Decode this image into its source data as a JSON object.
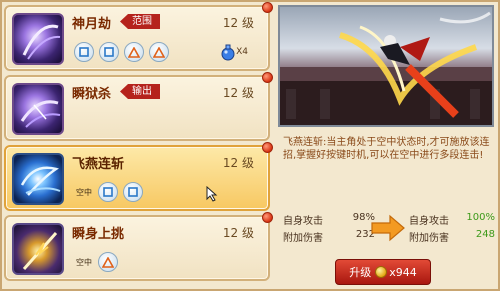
{
  "skills": [
    {
      "name": "神月劫",
      "tag": "范围",
      "level": "12 级",
      "potion_count": "X4",
      "combo": [
        "square",
        "square",
        "triangle",
        "triangle"
      ]
    },
    {
      "name": "瞬狱杀",
      "tag": "输出",
      "level": "12 级",
      "combo": []
    },
    {
      "name": "飞燕连斩",
      "level": "12 级",
      "combo_label": "空中",
      "combo": [
        "square",
        "square"
      ]
    },
    {
      "name": "瞬身上挑",
      "level": "12 级",
      "combo_label": "空中",
      "combo": [
        "triangle"
      ]
    }
  ],
  "detail": {
    "title": "飞燕连斩:",
    "text": "当主角处于空中状态时,才可施放该连招,掌握好按键时机,可以在空中进行多段连击!",
    "current": [
      {
        "label": "自身攻击",
        "value": "98%"
      },
      {
        "label": "附加伤害",
        "value": "232"
      }
    ],
    "next": [
      {
        "label": "自身攻击",
        "value": "100%"
      },
      {
        "label": "附加伤害",
        "value": "248"
      }
    ]
  },
  "upgrade": {
    "label": "升级",
    "cost": "x944"
  },
  "colors": {
    "accent_red": "#b5231c",
    "stat_green": "#3c9a1a",
    "active_card": "#f7c862"
  }
}
